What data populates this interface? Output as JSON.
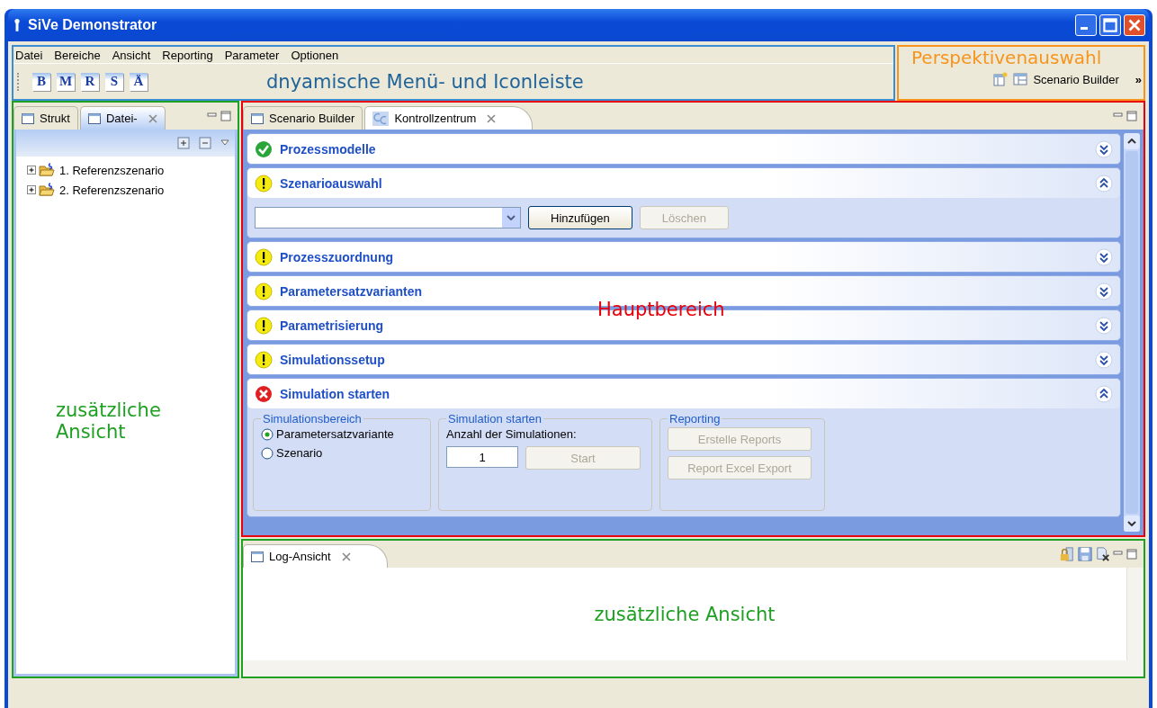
{
  "window": {
    "title": "SiVe Demonstrator"
  },
  "menu": [
    "Datei",
    "Bereiche",
    "Ansicht",
    "Reporting",
    "Parameter",
    "Optionen"
  ],
  "toolbar": [
    "B",
    "M",
    "R",
    "S",
    "Ä"
  ],
  "annotations": {
    "menu_area": "dnyamische Menü- und Iconleiste",
    "perspective": "Perspektivenauswahl",
    "main": "Hauptbereich",
    "left_view": "zusätzliche Ansicht",
    "log_view": "zusätzliche Ansicht"
  },
  "perspective": {
    "label": "Scenario Builder",
    "more": "»"
  },
  "left_view": {
    "tabs": [
      {
        "label": "Strukt",
        "selected": false,
        "closable": false
      },
      {
        "label": "Datei-",
        "selected": true,
        "closable": true
      }
    ],
    "tree": [
      {
        "label": "1. Referenzszenario",
        "expanded": false
      },
      {
        "label": "2. Referenzszenario",
        "expanded": false
      }
    ]
  },
  "editor": {
    "tabs": [
      {
        "label": "Scenario Builder",
        "selected": false,
        "closable": false
      },
      {
        "label": "Kontrollzentrum",
        "selected": true,
        "closable": true
      }
    ],
    "sections": [
      {
        "title": "Prozessmodelle",
        "kind": "ok",
        "expanded": false
      },
      {
        "title": "Szenarioauswahl",
        "kind": "warning",
        "expanded": true,
        "content": {
          "kind": "selection",
          "buttons": [
            {
              "label": "Hinzufügen",
              "disabled": false
            },
            {
              "label": "Löschen",
              "disabled": true
            }
          ]
        }
      },
      {
        "title": "Prozesszuordnung",
        "kind": "warning",
        "expanded": false
      },
      {
        "title": "Parametersatzvarianten",
        "kind": "warning",
        "expanded": false
      },
      {
        "title": "Parametrisierung",
        "kind": "warning",
        "expanded": false
      },
      {
        "title": "Simulationssetup",
        "kind": "warning",
        "expanded": false
      },
      {
        "title": "Simulation starten",
        "kind": "error",
        "expanded": true,
        "content": {
          "kind": "simulation",
          "range": {
            "title": "Simulationsbereich",
            "options": [
              {
                "label": "Parametersatzvariante",
                "selected": true
              },
              {
                "label": "Szenario",
                "selected": false
              }
            ]
          },
          "start": {
            "title": "Simulation starten",
            "count_label": "Anzahl der Simulationen:",
            "count_value": "1",
            "button": {
              "label": "Start",
              "disabled": true
            }
          },
          "reporting": {
            "title": "Reporting",
            "buttons": [
              {
                "label": "Erstelle Reports",
                "disabled": true
              },
              {
                "label": "Report Excel Export",
                "disabled": true
              }
            ]
          }
        }
      }
    ]
  },
  "log_view": {
    "tab": {
      "label": "Log-Ansicht",
      "selected": true,
      "closable": true
    }
  }
}
